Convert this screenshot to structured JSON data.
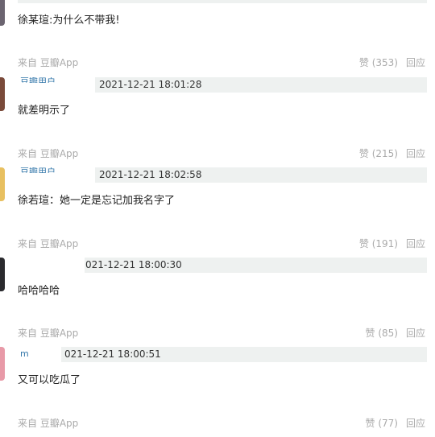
{
  "comments": [
    {
      "text": "徐某瑄:为什么不带我!",
      "source": "来自 豆瓣App",
      "like_label": "赞 (353)",
      "reply_label": "回应"
    },
    {
      "user": "豆瓣用户",
      "time": "2021-12-21 18:01:28",
      "text": "就差明示了",
      "source": "来自 豆瓣App",
      "like_label": "赞 (215)",
      "reply_label": "回应"
    },
    {
      "user": "豆瓣用户",
      "time": "2021-12-21 18:02:58",
      "text": "徐若瑄：她一定是忘记加我名字了",
      "source": "来自 豆瓣App",
      "like_label": "赞 (191)",
      "reply_label": "回应"
    },
    {
      "user": "",
      "time": "021-12-21 18:00:30",
      "text": "哈哈哈哈",
      "source": "来自 豆瓣App",
      "like_label": "赞 (85)",
      "reply_label": "回应"
    },
    {
      "user": "m",
      "time": "021-12-21 18:00:51",
      "text": "又可以吃瓜了",
      "source": "来自 豆瓣App",
      "like_label": "赞 (77)",
      "reply_label": "回应"
    }
  ],
  "colors": {
    "meta_bar": "#eef1f0",
    "muted_text": "#aaaaaa",
    "link": "#3377aa"
  }
}
